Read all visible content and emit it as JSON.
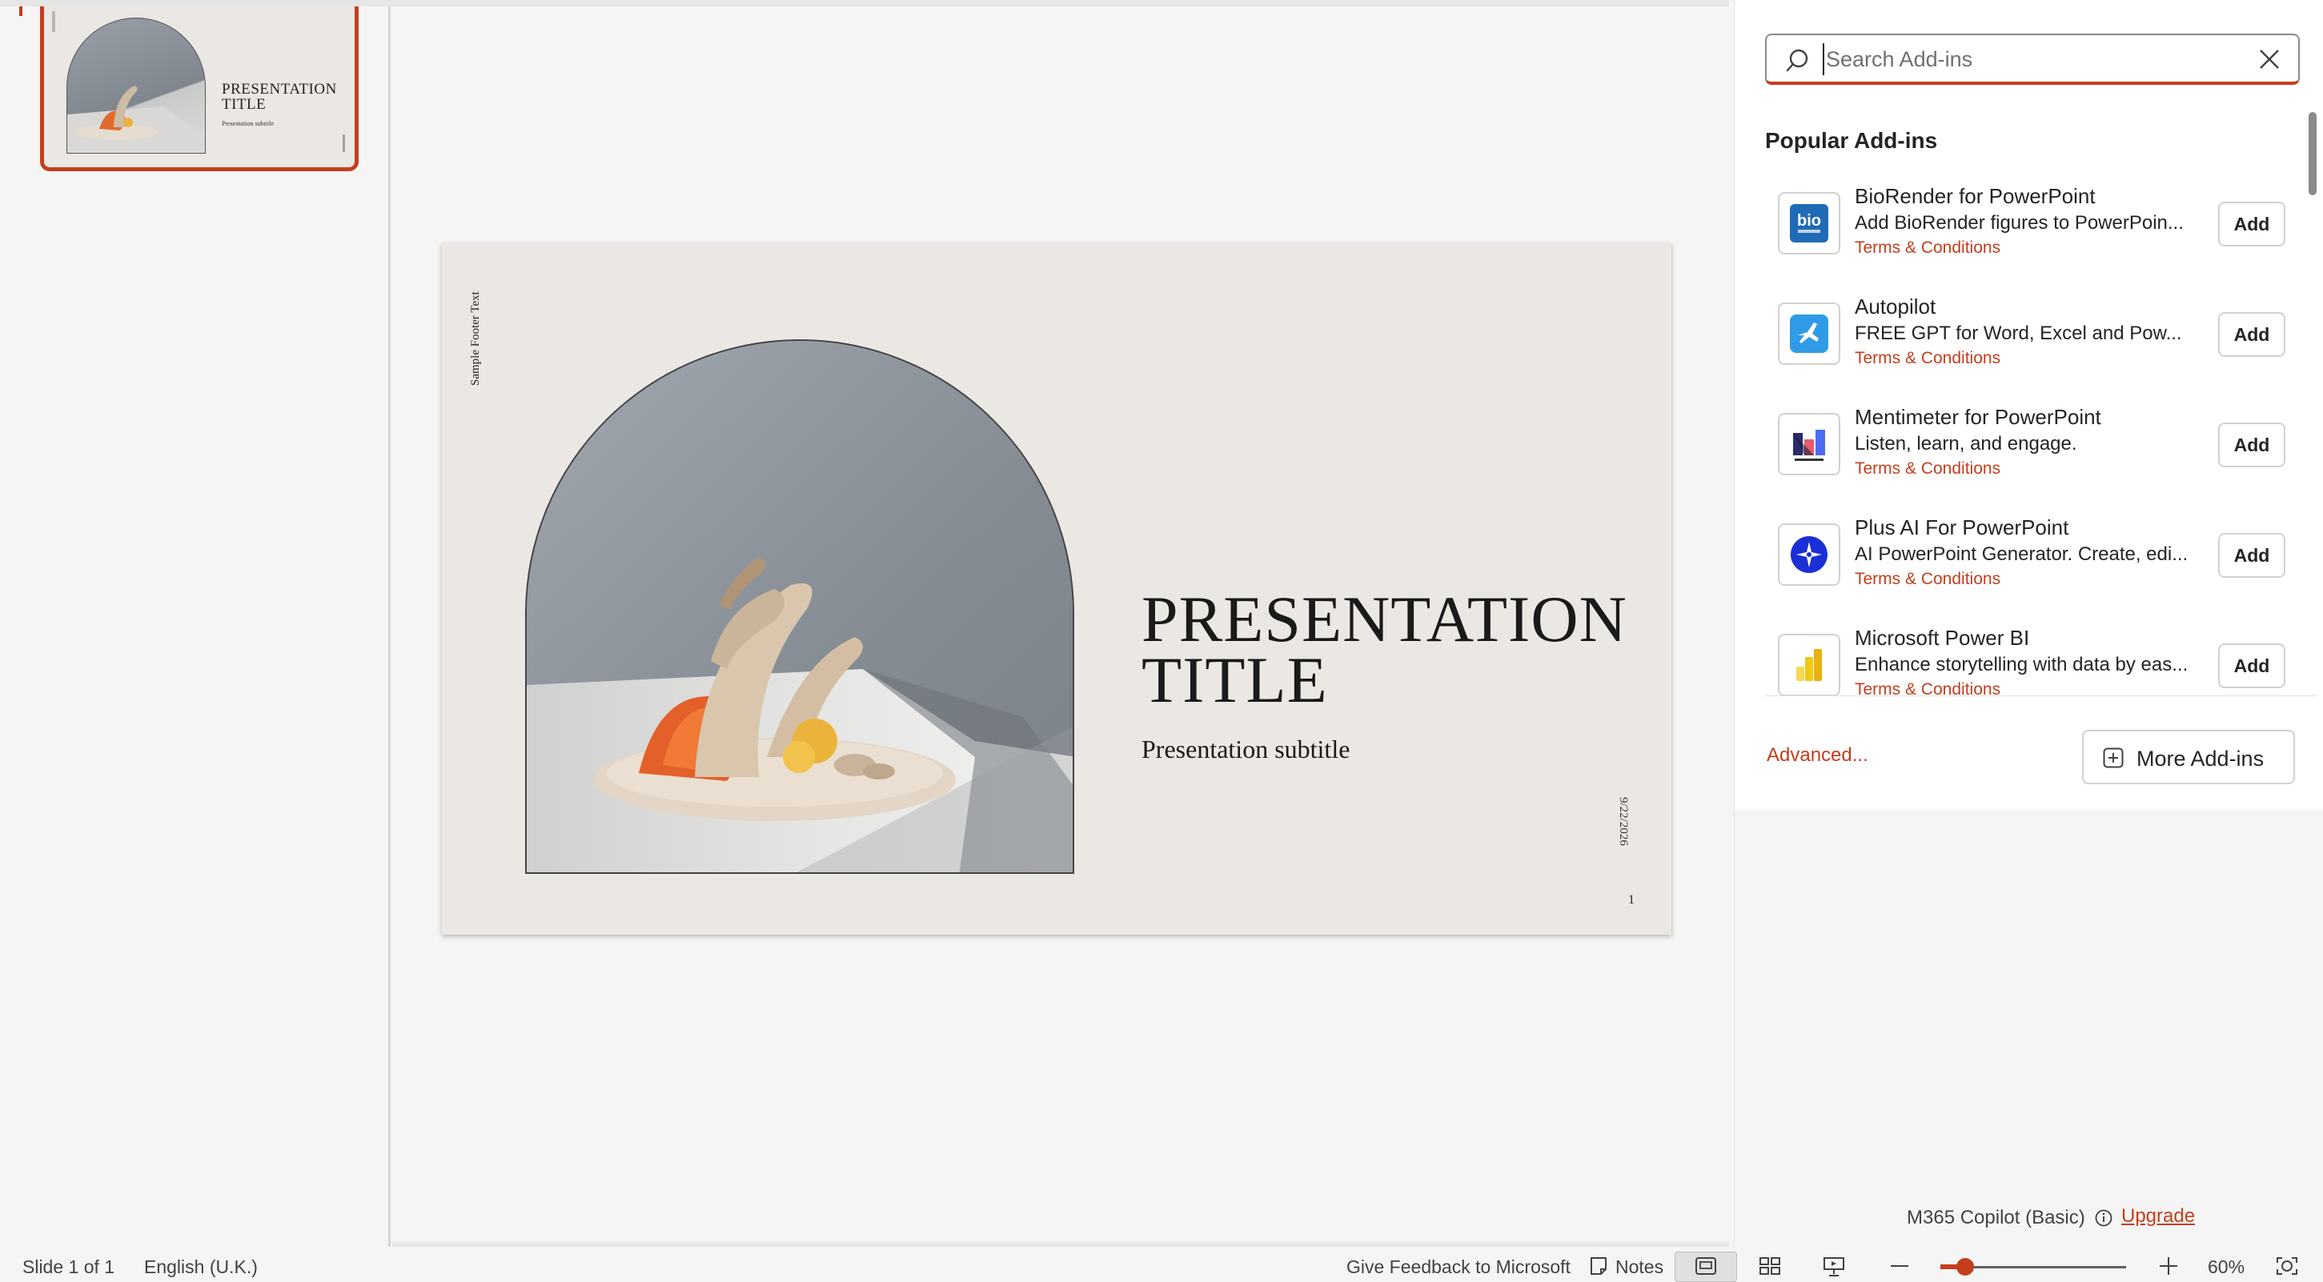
{
  "thumbnail": {
    "title_line1": "PRESENTATION",
    "title_line2": "TITLE",
    "subtitle": "Presentation subtitle"
  },
  "slide": {
    "footer_text": "Sample Footer Text",
    "title_line1": "PRESENTATION",
    "title_line2": "TITLE",
    "subtitle": "Presentation subtitle",
    "date": "9/22/2026",
    "number": "1"
  },
  "addins": {
    "search_placeholder": "Search Add-ins",
    "section_title": "Popular Add-ins",
    "items": [
      {
        "name": "BioRender for PowerPoint",
        "description": "Add BioRender figures to PowerPoin...",
        "terms": "Terms & Conditions",
        "button": "Add",
        "icon": "biorender-logo-icon"
      },
      {
        "name": "Autopilot",
        "description": "FREE GPT for Word, Excel and Pow...",
        "terms": "Terms & Conditions",
        "button": "Add",
        "icon": "autopilot-logo-icon"
      },
      {
        "name": "Mentimeter for PowerPoint",
        "description": "Listen, learn, and engage.",
        "terms": "Terms & Conditions",
        "button": "Add",
        "icon": "mentimeter-logo-icon"
      },
      {
        "name": "Plus AI For PowerPoint",
        "description": "AI PowerPoint Generator. Create, edi...",
        "terms": "Terms & Conditions",
        "button": "Add",
        "icon": "plus-ai-logo-icon"
      },
      {
        "name": "Microsoft Power BI",
        "description": "Enhance storytelling with data by eas...",
        "terms": "Terms & Conditions",
        "button": "Add",
        "icon": "power-bi-logo-icon"
      }
    ],
    "advanced_link": "Advanced...",
    "more_button": "More Add-ins",
    "copilot_label": "M365 Copilot (Basic)",
    "upgrade_link": "Upgrade",
    "biorender_logo_text": "bio"
  },
  "statusbar": {
    "slide_info": "Slide 1 of 1",
    "language": "English (U.K.)",
    "feedback": "Give Feedback to Microsoft",
    "notes": "Notes",
    "zoom": "60%",
    "zoom_level_percent": 60
  },
  "colors": {
    "accent": "#c43e1c",
    "slide_background": "#ebe7e3"
  }
}
